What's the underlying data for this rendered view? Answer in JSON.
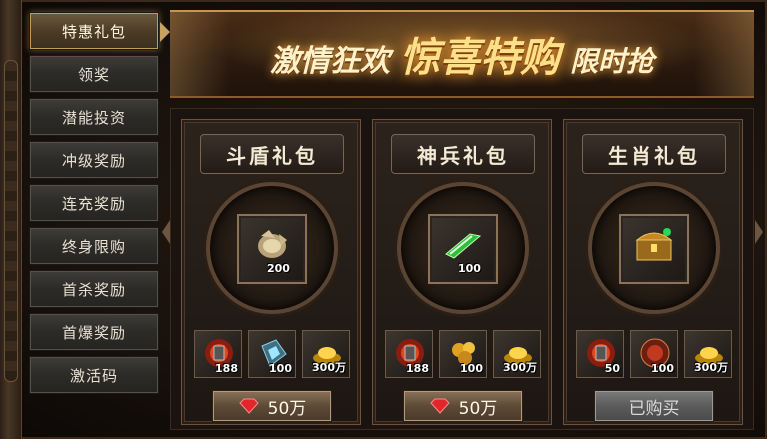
{
  "sidebar": {
    "items": [
      {
        "label": "特惠礼包",
        "active": true
      },
      {
        "label": "领奖",
        "active": false
      },
      {
        "label": "潜能投资",
        "active": false
      },
      {
        "label": "冲级奖励",
        "active": false
      },
      {
        "label": "连充奖励",
        "active": false
      },
      {
        "label": "终身限购",
        "active": false
      },
      {
        "label": "首杀奖励",
        "active": false
      },
      {
        "label": "首爆奖励",
        "active": false
      },
      {
        "label": "激活码",
        "active": false
      }
    ]
  },
  "banner": {
    "part1": "激情狂欢",
    "part2": "惊喜特购",
    "part3": "限时抢"
  },
  "packs": [
    {
      "title": "斗盾礼包",
      "main_item": {
        "icon": "shield-fragment-icon",
        "qty": "200"
      },
      "items": [
        {
          "icon": "red-rune-stone-icon",
          "qty": "188"
        },
        {
          "icon": "blue-crystal-icon",
          "qty": "100"
        },
        {
          "icon": "gold-ingot-icon",
          "qty": "300万"
        }
      ],
      "button": "50万",
      "bought": false
    },
    {
      "title": "神兵礼包",
      "main_item": {
        "icon": "green-blade-icon",
        "qty": "100"
      },
      "items": [
        {
          "icon": "red-rune-stone-icon",
          "qty": "188"
        },
        {
          "icon": "gold-ore-icon",
          "qty": "100"
        },
        {
          "icon": "gold-ingot-icon",
          "qty": "300万"
        }
      ],
      "button": "50万",
      "bought": false
    },
    {
      "title": "生肖礼包",
      "main_item": {
        "icon": "treasure-chest-icon",
        "qty": ""
      },
      "items": [
        {
          "icon": "red-rune-stone-icon",
          "qty": "50"
        },
        {
          "icon": "red-orb-icon",
          "qty": "100"
        },
        {
          "icon": "gold-ingot-icon",
          "qty": "300万"
        }
      ],
      "button": "已购买",
      "bought": true
    }
  ]
}
